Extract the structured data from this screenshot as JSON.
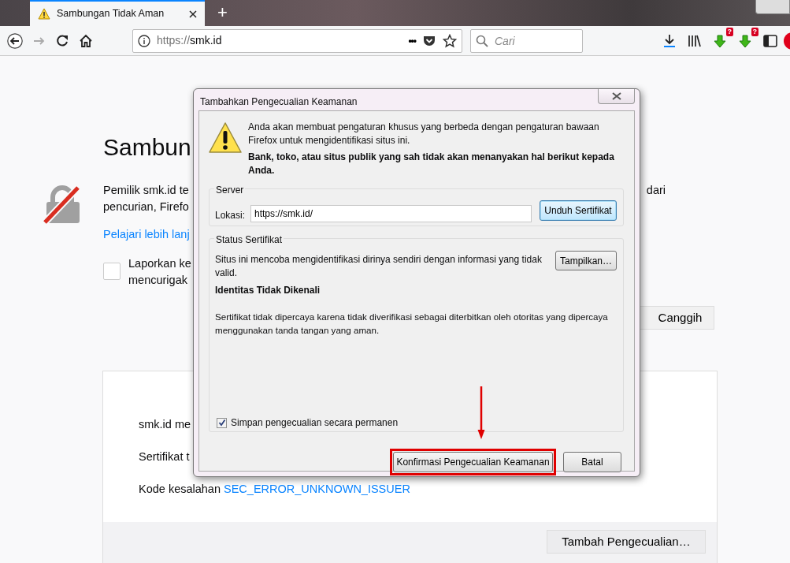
{
  "browser": {
    "tab": {
      "title": "Sambungan Tidak Aman",
      "selected": true
    },
    "new_tab": "+",
    "url_scheme": "https://",
    "url_host": "smk.id",
    "page_actions": "•••",
    "search": {
      "placeholder": "Cari"
    },
    "toolbar_badges": [
      "?",
      "?"
    ]
  },
  "page": {
    "title": "Sambun",
    "description_lines": [
      "Pemilik smk.id te",
      "pencurian, Firefo"
    ],
    "description_tail": "dari",
    "learn_more": "Pelajari lebih lanj",
    "report": {
      "checked": false,
      "lines": [
        "Laporkan ke",
        "mencurigak"
      ]
    },
    "advanced_button": "Canggih",
    "details": {
      "lines": [
        "smk.id me",
        "Sertifikat t"
      ],
      "error_label": "Kode kesalahan",
      "error_code": "SEC_ERROR_UNKNOWN_ISSUER",
      "add_exception_button": "Tambah Pengecualian…"
    }
  },
  "dialog": {
    "title": "Tambahkan Pengecualian Keamanan",
    "intro": "Anda akan membuat pengaturan khusus yang berbeda dengan pengaturan bawaan Firefox untuk mengidentifikasi situs ini.",
    "warning": "Bank, toko, atau situs publik yang sah tidak akan menanyakan hal berikut kepada Anda.",
    "server": {
      "legend": "Server",
      "location_label": "Lokasi:",
      "location_value": "https://smk.id/",
      "download_button": {
        "label": "Unduh Sertifikat",
        "focused": true
      }
    },
    "status": {
      "legend": "Status Sertifikat",
      "message": "Situs ini mencoba mengidentifikasi dirinya sendiri dengan informasi yang tidak valid.",
      "view_button": {
        "label": "Tampilkan…",
        "focused": false
      },
      "heading": "Identitas Tidak Dikenali",
      "detail": "Sertifikat tidak dipercaya karena tidak diverifikasi sebagai diterbitkan oleh otoritas yang dipercaya menggunakan tanda tangan yang aman."
    },
    "permanent": {
      "label": "Simpan pengecualian secara permanen",
      "checked": true
    },
    "buttons": [
      {
        "label": "Konfirmasi Pengecualian Keamanan",
        "highlighted": true
      },
      {
        "label": "Batal",
        "highlighted": false
      }
    ]
  }
}
